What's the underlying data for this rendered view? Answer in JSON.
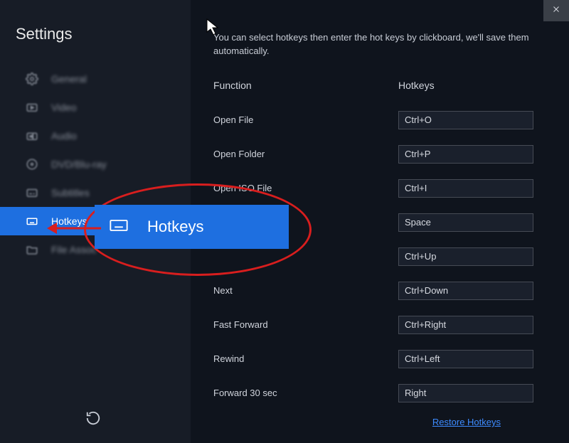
{
  "window": {
    "title": "Settings"
  },
  "sidebar": {
    "items": [
      {
        "label": "General"
      },
      {
        "label": "Video"
      },
      {
        "label": "Audio"
      },
      {
        "label": "DVD/Blu-ray"
      },
      {
        "label": "Subtitles"
      },
      {
        "label": "Hotkeys"
      },
      {
        "label": "File Assoc"
      }
    ]
  },
  "main": {
    "description": "You can select hotkeys then enter the hot keys by clickboard, we'll save them automatically.",
    "header_function": "Function",
    "header_hotkeys": "Hotkeys",
    "rows": [
      {
        "func": "Open File",
        "key": "Ctrl+O"
      },
      {
        "func": "Open Folder",
        "key": "Ctrl+P"
      },
      {
        "func": "Open ISO File",
        "key": "Ctrl+I"
      },
      {
        "func": "",
        "key": "Space"
      },
      {
        "func": "",
        "key": "Ctrl+Up"
      },
      {
        "func": "Next",
        "key": "Ctrl+Down"
      },
      {
        "func": "Fast Forward",
        "key": "Ctrl+Right"
      },
      {
        "func": "Rewind",
        "key": "Ctrl+Left"
      },
      {
        "func": "Forward 30 sec",
        "key": "Right"
      }
    ],
    "restore_label": "Restore Hotkeys"
  },
  "annotation": {
    "callout_label": "Hotkeys"
  }
}
